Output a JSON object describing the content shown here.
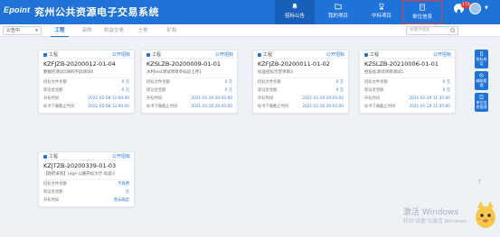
{
  "header": {
    "logo": "Epoint",
    "title": "兖州公共资源电子交易系统",
    "nav": [
      {
        "label": "招标公告",
        "icon": "bell-icon",
        "active": true
      },
      {
        "label": "我的项目",
        "icon": "folder-icon"
      },
      {
        "label": "中标项目",
        "icon": "trophy-icon"
      },
      {
        "label": "单位信息",
        "icon": "building-icon",
        "highlighted": true
      }
    ],
    "notification_count": "173"
  },
  "subbar": {
    "filter_value": "公告中",
    "tabs": [
      "工程",
      "采购",
      "权益交易",
      "土地",
      "矿权"
    ],
    "active_tab": "工程",
    "search_placeholder": "关键字搜索"
  },
  "cards": [
    {
      "type": "工程",
      "method": "公开招标",
      "code": "KZFJZB-20200012-01-04",
      "name": "数据检测试1随机字段测试6",
      "fields": [
        {
          "label": "招标文件金额",
          "value": "0 元"
        },
        {
          "label": "保证金金额",
          "value": "0 元"
        },
        {
          "label": "开标时间",
          "value": "2021-02-08 12:00:00"
        },
        {
          "label": "标书下载截止时间",
          "value": "2021-02-08 12:00:00"
        }
      ]
    },
    {
      "type": "工程",
      "method": "公开招标",
      "code": "KZSLZB-20200009-01-01",
      "name": "水利test测试项目单标段上传1",
      "fields": [
        {
          "label": "招标文件金额",
          "value": "0 元"
        },
        {
          "label": "保证金金额",
          "value": "0 元"
        },
        {
          "label": "开标时间",
          "value": "2021-01-20 20:45:00"
        },
        {
          "label": "标书下载截止时间",
          "value": "2021-01-20 20:45:00"
        }
      ]
    },
    {
      "type": "工程",
      "method": "公开招标",
      "code": "KZFJZB-20200011-01-02",
      "name": "标准招标示范项目3",
      "fields": [
        {
          "label": "招标文件金额",
          "value": "0 元"
        },
        {
          "label": "保证金金额",
          "value": "0 元"
        },
        {
          "label": "开标时间",
          "value": "2021-01-20 20:05:00"
        },
        {
          "label": "标书下载截止时间",
          "value": "2021-01-20 20:05:00"
        }
      ]
    },
    {
      "type": "工程",
      "method": "公开招标",
      "code": "KZSLZB-20210006-01-01",
      "name": "招投标测试项目测试1",
      "fields": [
        {
          "label": "招标文件金额",
          "value": "0 元"
        },
        {
          "label": "保证金金额",
          "value": "0 元"
        },
        {
          "label": "开标时间",
          "value": "2021-01-29 11:35:00"
        },
        {
          "label": "标书下载截止时间",
          "value": "2021-01-29 11:35:00"
        }
      ]
    },
    {
      "type": "工程",
      "method": "公开招标",
      "code": "KZJTZB-20200339-01-03",
      "name": "【政府采购】nige-公路开标大厅-标段3",
      "fields": [
        {
          "label": "招标文件金额",
          "value": "不收费"
        },
        {
          "label": "保证金金额",
          "value": "无"
        },
        {
          "label": "开标时间",
          "value": "暂未确定"
        }
      ]
    }
  ],
  "side_panel": [
    "投标电话",
    "辅助管理",
    "单位信息管理"
  ],
  "watermark": {
    "line1": "激活 Windows",
    "line2": "转到\"设置\"以激活 Windows"
  },
  "colors": {
    "primary": "#1e72d8",
    "highlight_border": "#e23b3b",
    "value_text": "#3a7fd5"
  }
}
